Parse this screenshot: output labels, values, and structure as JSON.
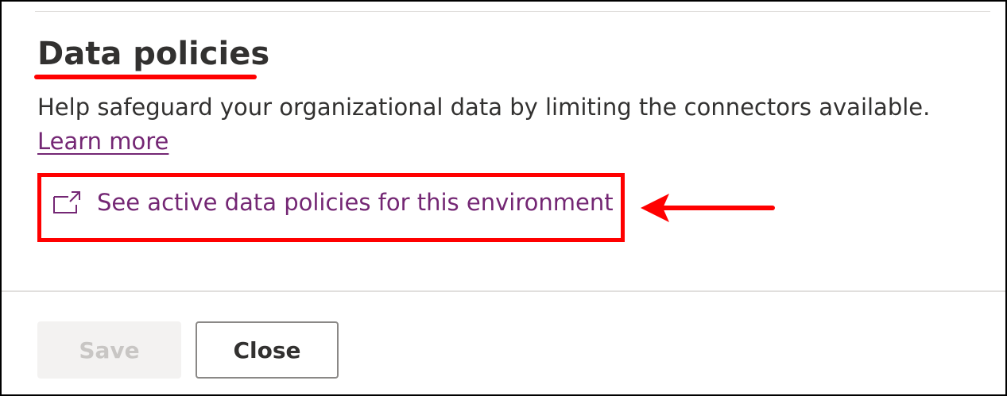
{
  "section": {
    "title": "Data policies",
    "description": "Help safeguard your organizational data by limiting the connectors available. ",
    "learn_more_label": "Learn more"
  },
  "policies_link": {
    "icon": "open-in-new-window-icon",
    "label": "See active data policies for this environment"
  },
  "annotations": {
    "color": "#ff0000",
    "arrow_direction": "left"
  },
  "footer": {
    "save_label": "Save",
    "close_label": "Close"
  },
  "colors": {
    "link": "#742774",
    "text": "#323130",
    "disabled_bg": "#f3f2f1",
    "disabled_text": "#c8c6c4"
  }
}
